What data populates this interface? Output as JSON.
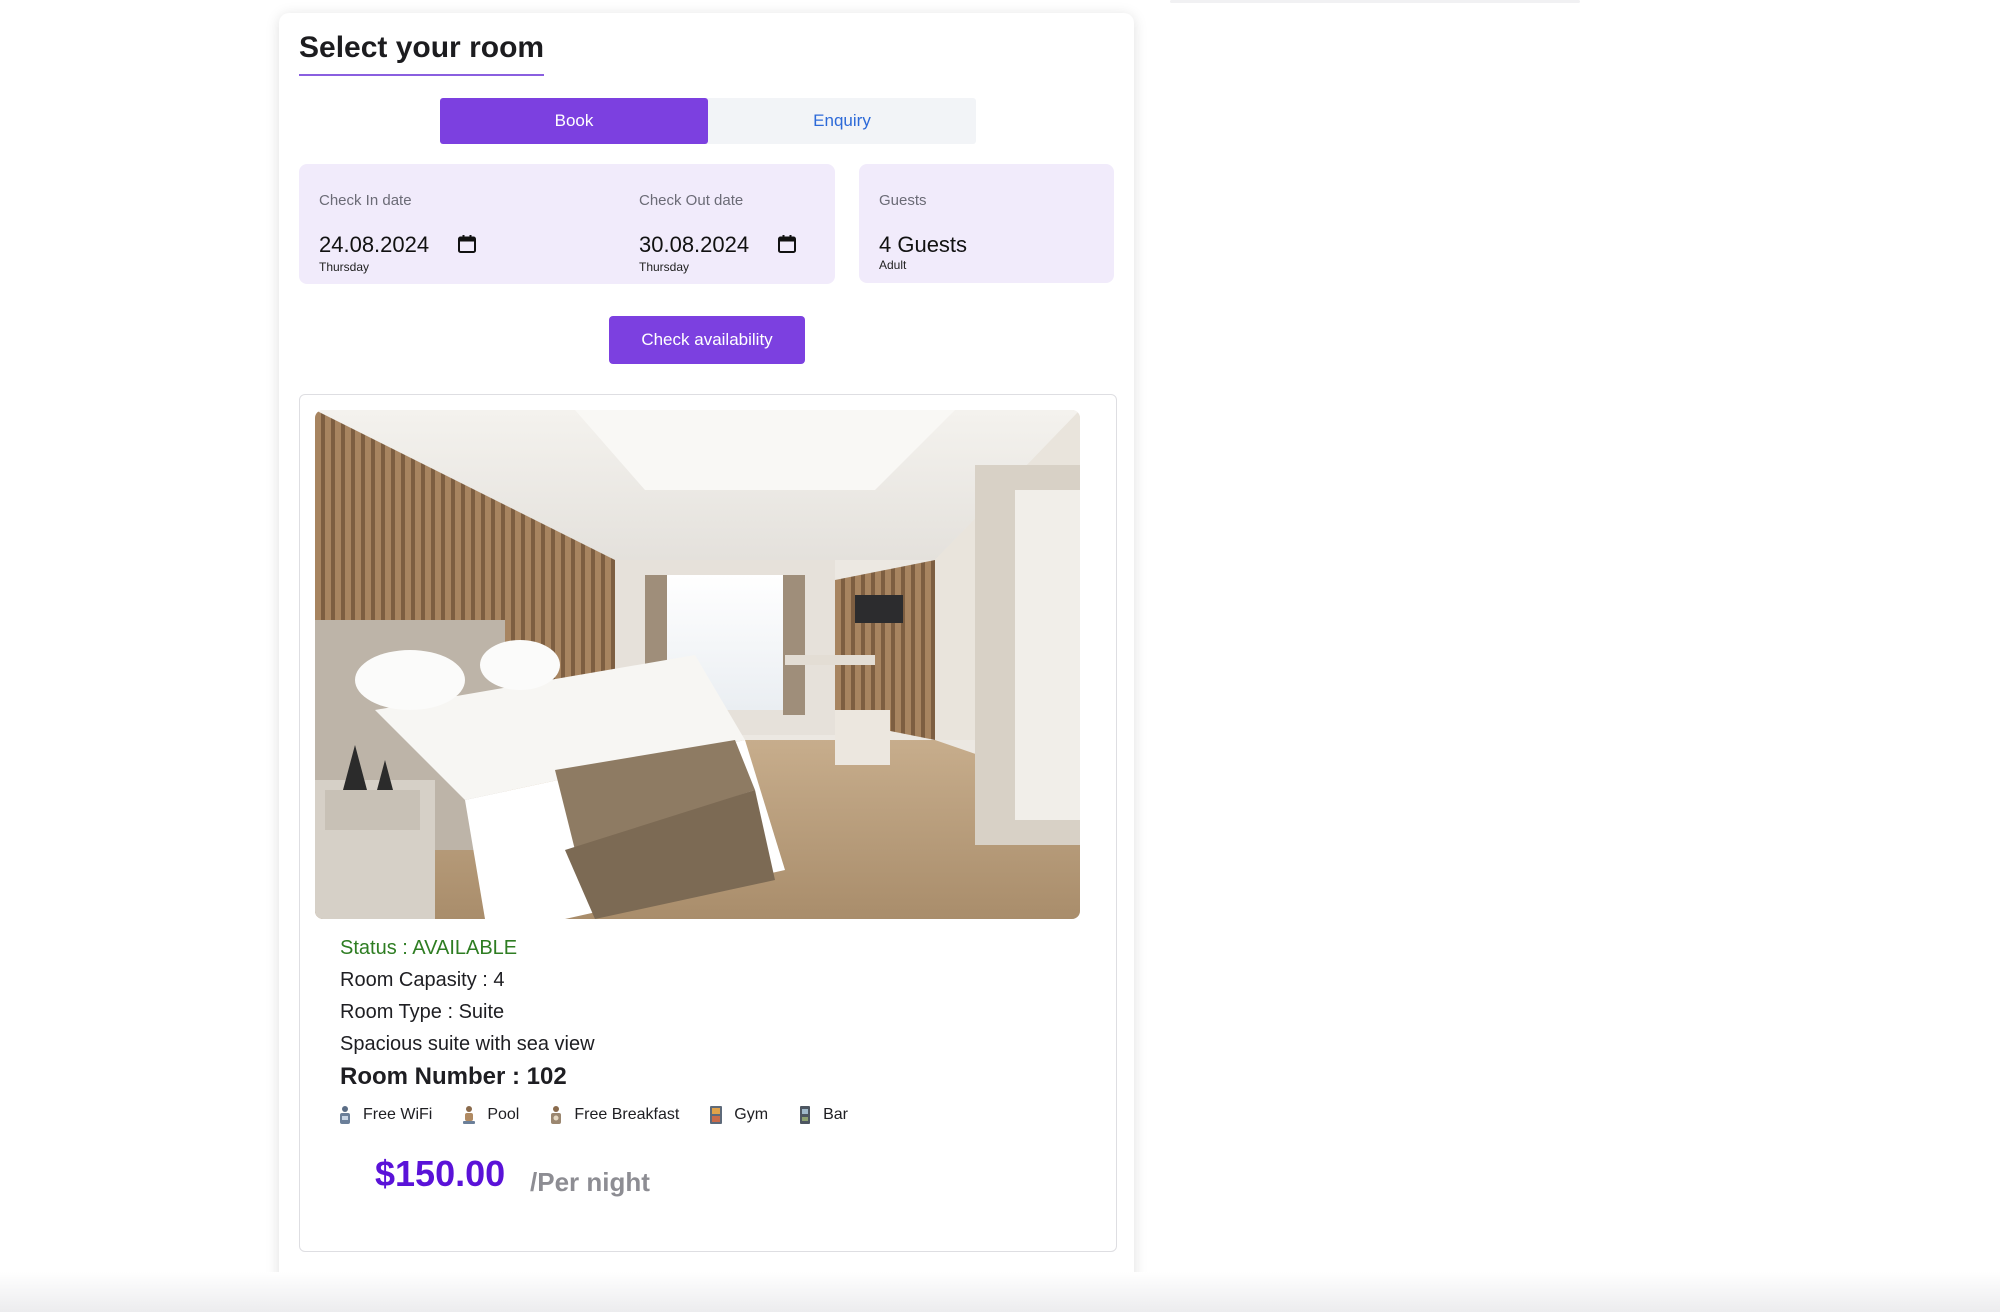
{
  "page": {
    "title": "Select your room"
  },
  "tabs": {
    "book": "Book",
    "enquiry": "Enquiry"
  },
  "booking": {
    "check_in": {
      "label": "Check In date",
      "value": "24.08.2024",
      "day": "Thursday"
    },
    "check_out": {
      "label": "Check Out date",
      "value": "30.08.2024",
      "day": "Thursday"
    },
    "guests": {
      "label": "Guests",
      "value": "4 Guests",
      "type": "Adult"
    },
    "check_button": "Check availability"
  },
  "room": {
    "status": "Status : AVAILABLE",
    "capacity": "Room Capasity : 4",
    "type": "Room Type : Suite",
    "description": "Spacious suite with sea view",
    "number": "Room Number : 102",
    "amenities": [
      {
        "label": "Free WiFi",
        "icon": "wifi-icon"
      },
      {
        "label": "Pool",
        "icon": "pool-icon"
      },
      {
        "label": "Free Breakfast",
        "icon": "breakfast-icon"
      },
      {
        "label": "Gym",
        "icon": "gym-icon"
      },
      {
        "label": "Bar",
        "icon": "bar-icon"
      }
    ],
    "price": "$150.00",
    "price_unit": "/Per night"
  },
  "colors": {
    "accent": "#7c40e0",
    "price": "#5a12d8",
    "status": "#2e7d22",
    "field_background": "#f1ebfb"
  }
}
